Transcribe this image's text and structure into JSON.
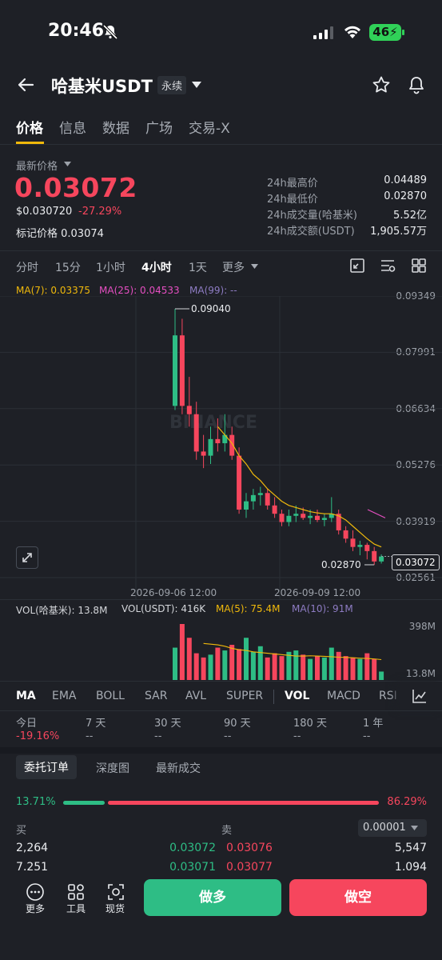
{
  "status": {
    "time": "20:46",
    "battery": "46"
  },
  "header": {
    "pair": "哈基米USDT",
    "badge": "永续"
  },
  "tabs": [
    "价格",
    "信息",
    "数据",
    "广场",
    "交易-X"
  ],
  "price": {
    "last_label": "最新价格",
    "last": "0.03072",
    "usd": "$0.030720",
    "change": "-27.29%",
    "mark": "标记价格 0.03074"
  },
  "stats": [
    {
      "label": "24h最高价",
      "value": "0.04489"
    },
    {
      "label": "24h最低价",
      "value": "0.02870"
    },
    {
      "label": "24h成交量(哈基米)",
      "value": "5.52亿"
    },
    {
      "label": "24h成交额(USDT)",
      "value": "1,905.57万"
    }
  ],
  "intervals": [
    "分时",
    "15分",
    "1小时",
    "4小时",
    "1天",
    "更多"
  ],
  "ma_legend": {
    "ma7": "MA(7): 0.03375",
    "ma25": "MA(25): 0.04533",
    "ma99": "MA(99): --"
  },
  "colors": {
    "up": "#2ebd85",
    "down": "#f6465d",
    "ma7": "#f0b90b",
    "ma25": "#e64fc2",
    "ma99": "#8e7cc3",
    "accent": "#f0b90b"
  },
  "chart_data": {
    "type": "candlestick",
    "price_axis": [
      "0.09349",
      "0.07991",
      "0.06634",
      "0.05276",
      "0.03919",
      "0.02561"
    ],
    "x_labels": [
      "2026-09-06 12:00",
      "2026-09-09 12:00"
    ],
    "high_marker": "0.09040",
    "low_marker": "0.02870",
    "current_price": "0.03072",
    "watermark": "BINANCE",
    "candles": [
      {
        "o": 0.067,
        "h": 0.0904,
        "l": 0.066,
        "c": 0.084
      },
      {
        "o": 0.084,
        "h": 0.088,
        "l": 0.065,
        "c": 0.067
      },
      {
        "o": 0.067,
        "h": 0.074,
        "l": 0.062,
        "c": 0.065
      },
      {
        "o": 0.065,
        "h": 0.068,
        "l": 0.054,
        "c": 0.056
      },
      {
        "o": 0.056,
        "h": 0.06,
        "l": 0.052,
        "c": 0.055
      },
      {
        "o": 0.055,
        "h": 0.062,
        "l": 0.053,
        "c": 0.059
      },
      {
        "o": 0.059,
        "h": 0.064,
        "l": 0.056,
        "c": 0.058
      },
      {
        "o": 0.058,
        "h": 0.065,
        "l": 0.056,
        "c": 0.06
      },
      {
        "o": 0.06,
        "h": 0.062,
        "l": 0.054,
        "c": 0.055
      },
      {
        "o": 0.055,
        "h": 0.057,
        "l": 0.041,
        "c": 0.042
      },
      {
        "o": 0.042,
        "h": 0.046,
        "l": 0.04,
        "c": 0.044
      },
      {
        "o": 0.044,
        "h": 0.047,
        "l": 0.042,
        "c": 0.0455
      },
      {
        "o": 0.0455,
        "h": 0.0475,
        "l": 0.043,
        "c": 0.046
      },
      {
        "o": 0.046,
        "h": 0.047,
        "l": 0.042,
        "c": 0.043
      },
      {
        "o": 0.043,
        "h": 0.045,
        "l": 0.04,
        "c": 0.041
      },
      {
        "o": 0.041,
        "h": 0.042,
        "l": 0.038,
        "c": 0.039
      },
      {
        "o": 0.039,
        "h": 0.042,
        "l": 0.038,
        "c": 0.0405
      },
      {
        "o": 0.0405,
        "h": 0.043,
        "l": 0.039,
        "c": 0.041
      },
      {
        "o": 0.041,
        "h": 0.0425,
        "l": 0.0395,
        "c": 0.04
      },
      {
        "o": 0.04,
        "h": 0.042,
        "l": 0.0385,
        "c": 0.0405
      },
      {
        "o": 0.0405,
        "h": 0.042,
        "l": 0.039,
        "c": 0.0395
      },
      {
        "o": 0.0395,
        "h": 0.041,
        "l": 0.038,
        "c": 0.04
      },
      {
        "o": 0.04,
        "h": 0.045,
        "l": 0.039,
        "c": 0.041
      },
      {
        "o": 0.041,
        "h": 0.042,
        "l": 0.036,
        "c": 0.037
      },
      {
        "o": 0.037,
        "h": 0.038,
        "l": 0.034,
        "c": 0.035
      },
      {
        "o": 0.035,
        "h": 0.037,
        "l": 0.032,
        "c": 0.033
      },
      {
        "o": 0.033,
        "h": 0.0345,
        "l": 0.031,
        "c": 0.0335
      },
      {
        "o": 0.0335,
        "h": 0.034,
        "l": 0.03,
        "c": 0.032
      },
      {
        "o": 0.032,
        "h": 0.033,
        "l": 0.0287,
        "c": 0.0295
      },
      {
        "o": 0.0295,
        "h": 0.0312,
        "l": 0.029,
        "c": 0.0307
      }
    ],
    "ma7": [
      null,
      null,
      null,
      null,
      null,
      null,
      0.062,
      0.06,
      0.058,
      0.055,
      0.053,
      0.0505,
      0.049,
      0.047,
      0.0455,
      0.044,
      0.043,
      0.0425,
      0.042,
      0.0415,
      0.0412,
      0.041,
      0.041,
      0.0405,
      0.0395,
      0.038,
      0.0365,
      0.035,
      0.0337,
      0.033
    ],
    "ma25_segment": [
      0.042,
      0.04
    ]
  },
  "volume": {
    "legend_vol": "VOL(哈基米): 13.8M",
    "legend_usdt": "VOL(USDT): 416K",
    "legend_ma5": "MA(5): 75.4M",
    "legend_ma10": "MA(10): 91M",
    "axis_top": "398M",
    "axis_bottom": "13.8M",
    "values_m": [
      230,
      398,
      300,
      190,
      160,
      180,
      230,
      210,
      250,
      220,
      300,
      200,
      240,
      160,
      190,
      170,
      200,
      210,
      180,
      150,
      170,
      160,
      230,
      200,
      170,
      160,
      150,
      190,
      150,
      60
    ],
    "ma5_m": [
      null,
      null,
      null,
      null,
      260,
      255,
      250,
      240,
      225,
      215,
      210,
      200,
      195,
      190,
      185,
      180,
      175,
      170,
      170,
      172,
      170,
      168,
      165,
      162,
      160,
      158,
      155,
      153,
      150,
      145
    ]
  },
  "indicator_tabs": [
    "MA",
    "EMA",
    "BOLL",
    "SAR",
    "AVL",
    "SUPER",
    "VOL",
    "MACD",
    "RSI"
  ],
  "performance": [
    {
      "label": "今日",
      "value": "-19.16%"
    },
    {
      "label": "7 天",
      "value": "--"
    },
    {
      "label": "30 天",
      "value": "--"
    },
    {
      "label": "90 天",
      "value": "--"
    },
    {
      "label": "180 天",
      "value": "--"
    },
    {
      "label": "1 年",
      "value": "--"
    }
  ],
  "orderbook": {
    "tabs": [
      "委托订单",
      "深度图",
      "最新成交"
    ],
    "buy_pct": "13.71%",
    "sell_pct": "86.29%",
    "buy_ratio": 0.1371,
    "buy_label": "买",
    "sell_label": "卖",
    "precision": "0.00001",
    "rows": [
      {
        "buy_qty": "2,264",
        "buy_price": "0.03072",
        "sell_price": "0.03076",
        "sell_qty": "5,547"
      },
      {
        "buy_qty": "7,251",
        "buy_price": "0.03071",
        "sell_price": "0.03077",
        "sell_qty": "1,094"
      }
    ]
  },
  "bottom": {
    "more": "更多",
    "tools": "工具",
    "spot": "现货",
    "long": "做多",
    "short": "做空"
  }
}
